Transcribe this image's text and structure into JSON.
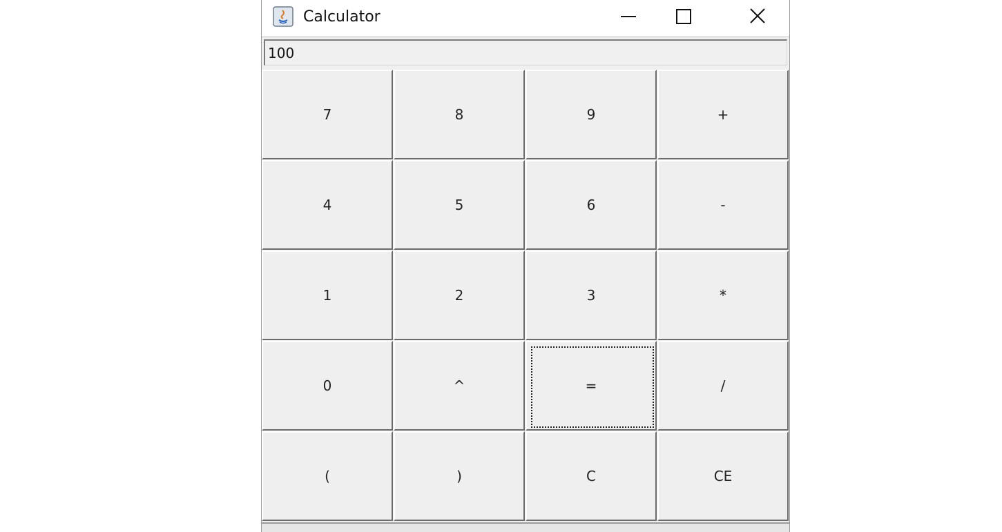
{
  "window": {
    "title": "Calculator",
    "controls": {
      "minimize": "minimize-icon",
      "maximize": "maximize-icon",
      "close": "close-icon"
    }
  },
  "display": {
    "value": "100"
  },
  "keypad": {
    "rows": [
      [
        "7",
        "8",
        "9",
        "+"
      ],
      [
        "4",
        "5",
        "6",
        "-"
      ],
      [
        "1",
        "2",
        "3",
        "*"
      ],
      [
        "0",
        "^",
        "=",
        "/"
      ],
      [
        "(",
        ")",
        "C",
        "CE"
      ]
    ],
    "focused_key": "="
  },
  "colors": {
    "window_bg": "#f0f0f0",
    "titlebar_bg": "#ffffff",
    "key_shadow": "#6b6b6b",
    "text": "#222222"
  }
}
